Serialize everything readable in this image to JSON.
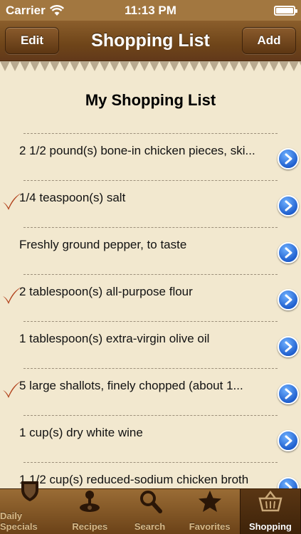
{
  "status_bar": {
    "carrier": "Carrier",
    "time": "11:13 PM",
    "battery_level": 1.0
  },
  "nav": {
    "title": "Shopping List",
    "left_button": "Edit",
    "right_button": "Add"
  },
  "list": {
    "title": "My Shopping List",
    "items": [
      {
        "text": "2 1/2 pound(s) bone-in chicken pieces, ski...",
        "checked": false
      },
      {
        "text": "1/4 teaspoon(s) salt",
        "checked": true
      },
      {
        "text": "Freshly ground pepper, to taste",
        "checked": false
      },
      {
        "text": "2 tablespoon(s) all-purpose flour",
        "checked": true
      },
      {
        "text": "1 tablespoon(s) extra-virgin olive oil",
        "checked": false
      },
      {
        "text": "5  large shallots, finely chopped (about 1...",
        "checked": true
      },
      {
        "text": "1 cup(s) dry white wine",
        "checked": false
      },
      {
        "text": "1 1/2 cup(s) reduced-sodium chicken broth",
        "checked": false
      }
    ]
  },
  "tabs": [
    {
      "label": "Daily Specials",
      "icon": "shield-icon",
      "active": false
    },
    {
      "label": "Recipes",
      "icon": "joystick-icon",
      "active": false
    },
    {
      "label": "Search",
      "icon": "search-icon",
      "active": false
    },
    {
      "label": "Favorites",
      "icon": "star-icon",
      "active": false
    },
    {
      "label": "Shopping",
      "icon": "basket-icon",
      "active": true
    }
  ],
  "colors": {
    "paper": "#f2e8cf",
    "leather": "#6f4519",
    "check": "#b1411b",
    "disclosure": "#2060cf"
  }
}
